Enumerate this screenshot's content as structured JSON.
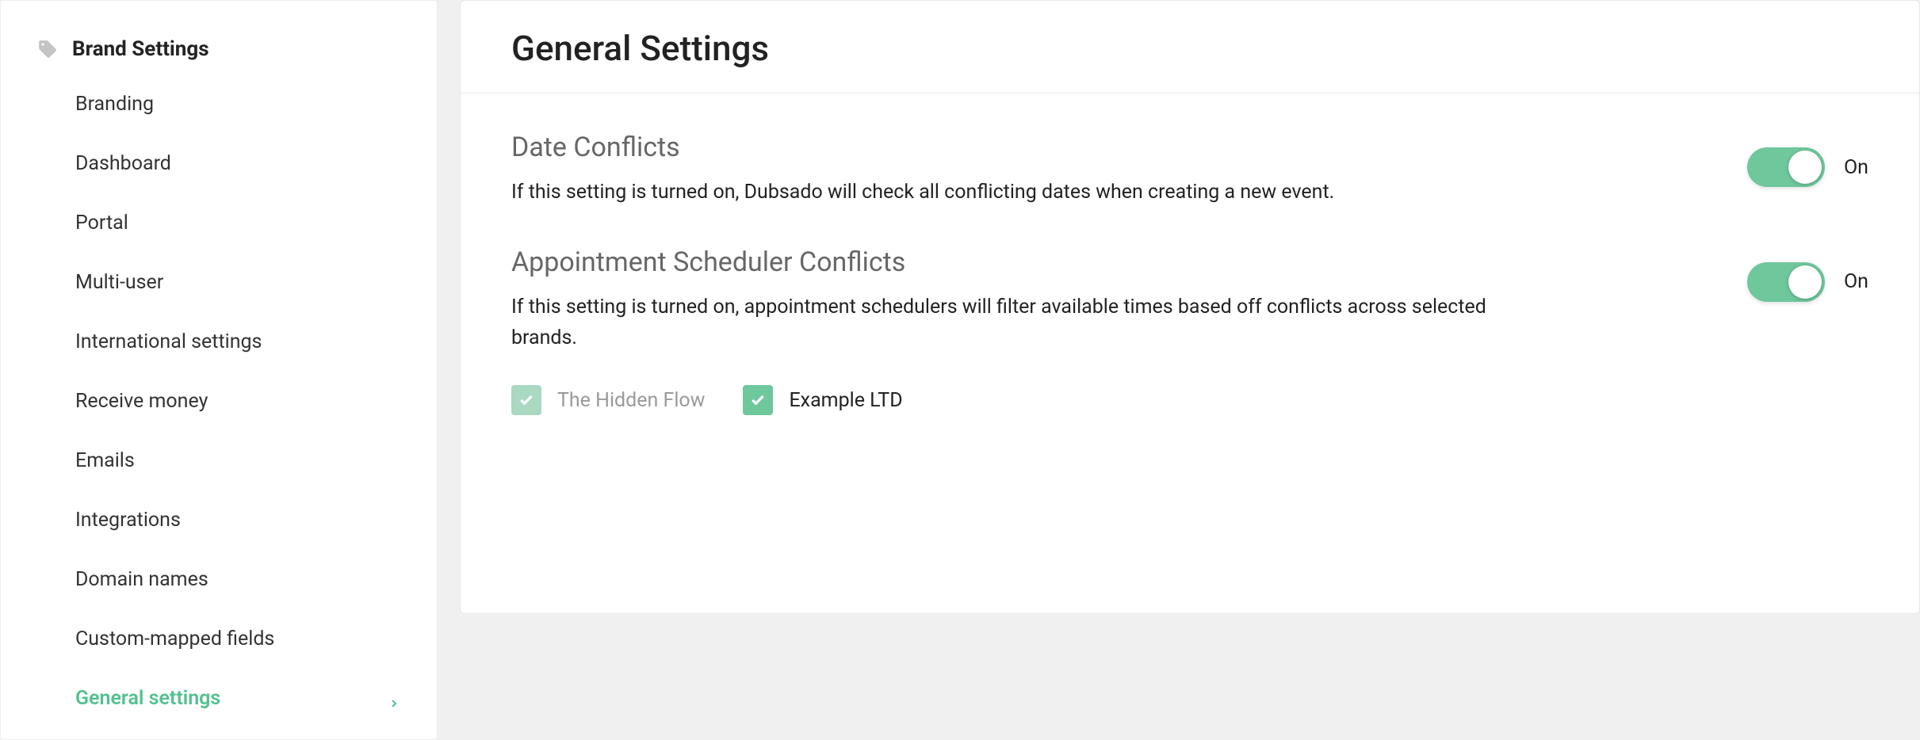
{
  "sidebar": {
    "title": "Brand Settings",
    "items": [
      {
        "label": "Branding",
        "active": false
      },
      {
        "label": "Dashboard",
        "active": false
      },
      {
        "label": "Portal",
        "active": false
      },
      {
        "label": "Multi-user",
        "active": false
      },
      {
        "label": "International settings",
        "active": false
      },
      {
        "label": "Receive money",
        "active": false
      },
      {
        "label": "Emails",
        "active": false
      },
      {
        "label": "Integrations",
        "active": false
      },
      {
        "label": "Domain names",
        "active": false
      },
      {
        "label": "Custom-mapped fields",
        "active": false
      },
      {
        "label": "General settings",
        "active": true
      }
    ]
  },
  "page": {
    "title": "General Settings",
    "settings": [
      {
        "heading": "Date Conflicts",
        "description": "If this setting is turned on, Dubsado will check all conflicting dates when creating a new event.",
        "toggle_on": true,
        "toggle_label": "On"
      },
      {
        "heading": "Appointment Scheduler Conflicts",
        "description": "If this setting is turned on, appointment schedulers will filter available times based off conflicts across selected brands.",
        "toggle_on": true,
        "toggle_label": "On",
        "brands": [
          {
            "label": "The Hidden Flow",
            "checked": true,
            "editable": false
          },
          {
            "label": "Example LTD",
            "checked": true,
            "editable": true
          }
        ]
      }
    ]
  }
}
